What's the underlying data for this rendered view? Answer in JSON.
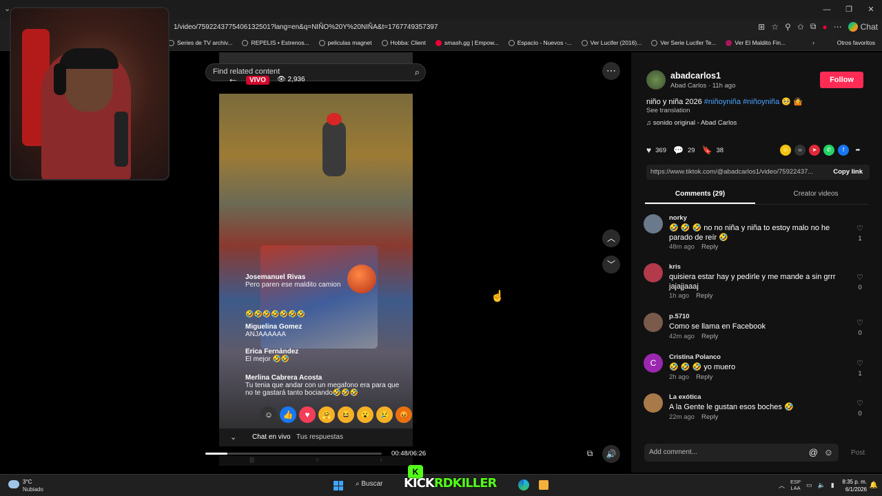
{
  "browser": {
    "url": "1/video/7592243775406132501?lang=en&q=NIÑO%20Y%20NIÑA&t=1767749357397",
    "chat_label": "Chat",
    "bookmarks": [
      {
        "label": "Series de TV archiv...",
        "icon": "folder-icon"
      },
      {
        "label": "REPELIS • Estrenos...",
        "icon": "globe-icon"
      },
      {
        "label": "peliculas magnet",
        "icon": "globe-icon"
      },
      {
        "label": "Hobba: Client",
        "icon": "hobba-icon"
      },
      {
        "label": "smash.gg | Empow...",
        "icon": "smashgg-icon"
      },
      {
        "label": "Espacio - Nuevos -...",
        "icon": "globe-icon"
      },
      {
        "label": "Ver Lucifer (2016)...",
        "icon": "globe-icon"
      },
      {
        "label": "Ver Serie Lucifer Te...",
        "icon": "globe-icon"
      },
      {
        "label": "Ver El Maldito Fin...",
        "icon": "bookmark-icon"
      }
    ],
    "other_bookmarks": "Otros favoritos"
  },
  "player": {
    "search_placeholder": "Find related content",
    "live_badge": "VIVO",
    "viewer_count": "2,936",
    "time": "00:48/06:26",
    "progress": 0.125,
    "live_comments": [
      {
        "name": "Josemanuel Rivas",
        "text": "Pero paren ese maldito camion"
      },
      {
        "name": "",
        "text": "🤣🤣🤣🤣🤣🤣🤣"
      },
      {
        "name": "Miguelina Gomez",
        "text": "ANJAAAAAA"
      },
      {
        "name": "Erica Fernández",
        "text": "El mejor 🤣🤣"
      },
      {
        "name": "Merlina Cabrera Acosta",
        "text": "Tu tenia que andar con un megafono era para que no te gastará tanto bociando🤣🤣🤣"
      }
    ],
    "live_footer": {
      "chat": "Chat en vivo",
      "replies": "Tus respuestas"
    }
  },
  "post": {
    "author": "abadcarlos1",
    "author_sub": "Abad Carlos · 11h ago",
    "follow": "Follow",
    "caption_text": "niño y niña 2026 ",
    "caption_tags": "#niñoyniña #niñoyniña",
    "caption_emoji": " 🥺 🤷",
    "see_translation": "See translation",
    "sound": "sonido original - Abad Carlos",
    "likes": "369",
    "comments": "29",
    "saves": "38",
    "link": "https://www.tiktok.com/@abadcarlos1/video/75922437...",
    "copy_link": "Copy link",
    "tab_comments": "Comments (29)",
    "tab_creator": "Creator videos"
  },
  "comments": [
    {
      "name": "norky",
      "text": "🤣 🤣 🤣 no no niña y niña to estoy malo no he parado de reír 🤣",
      "time": "48m ago",
      "reply": "Reply",
      "likes": "1",
      "avatar_color": "#6a7a8a"
    },
    {
      "name": "kris",
      "text": "quisiera estar hay y pedirle y me mande a sin grrr jajajjaaaj",
      "time": "1h ago",
      "reply": "Reply",
      "likes": "0",
      "avatar_color": "#b23a4a"
    },
    {
      "name": "p.5710",
      "text": "Como se llama en Facebook",
      "time": "42m ago",
      "reply": "Reply",
      "likes": "0",
      "avatar_color": "#7a5a4a"
    },
    {
      "name": "Cristina Polanco",
      "text": "🤣 🤣 🤣 yo muero",
      "time": "2h ago",
      "reply": "Reply",
      "likes": "1",
      "avatar_color": "#9b27b0",
      "initial": "C"
    },
    {
      "name": "La exótica",
      "text": "A la Gente le gustan esos boches 🤣",
      "time": "22m ago",
      "reply": "Reply",
      "likes": "0",
      "avatar_color": "#a87a4a"
    }
  ],
  "composer": {
    "placeholder": "Add comment...",
    "post": "Post"
  },
  "taskbar": {
    "temp": "3°C",
    "weather": "Nubiado",
    "search": "Buscar",
    "kick_text": "KICK",
    "kick_name": "RDKILLER",
    "lang_top": "ESP",
    "lang_bottom": "LAA",
    "time": "8:35 p. m.",
    "date": "6/1/2026"
  }
}
